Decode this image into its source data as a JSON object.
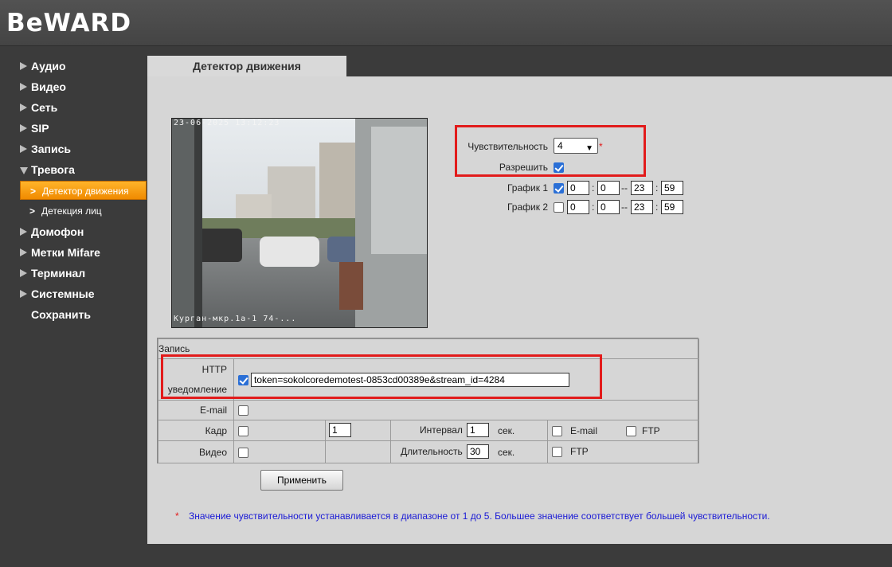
{
  "header": {
    "logo": "BeWARD"
  },
  "sidebar": {
    "items": [
      {
        "label": "Аудио"
      },
      {
        "label": "Видео"
      },
      {
        "label": "Сеть"
      },
      {
        "label": "SIP"
      },
      {
        "label": "Запись"
      },
      {
        "label": "Тревога"
      },
      {
        "label": "Домофон"
      },
      {
        "label": "Метки Mifare"
      },
      {
        "label": "Терминал"
      },
      {
        "label": "Системные"
      },
      {
        "label": "Сохранить"
      }
    ],
    "subitems": [
      {
        "label": "Детектор движения",
        "active": true
      },
      {
        "label": "Детекция лиц",
        "active": false
      }
    ]
  },
  "tab": {
    "label": "Детектор движения"
  },
  "camera": {
    "timestamp": "23-06-2025 13:12:23",
    "caption": "Курган-мкр.1а-1 74-..."
  },
  "settings": {
    "sensitivity_label": "Чувствительность",
    "sensitivity_value": "4",
    "asterisk": "*",
    "enable_label": "Разрешить",
    "schedule1_label": "График 1",
    "schedule1": {
      "h1": "0",
      "m1": "0",
      "h2": "23",
      "m2": "59"
    },
    "schedule2_label": "График 2",
    "schedule2": {
      "h1": "0",
      "m1": "0",
      "h2": "23",
      "m2": "59"
    },
    "colon": ":",
    "dash": "--"
  },
  "record": {
    "title": "Запись",
    "http_label_1": "HTTP",
    "http_label_2": "уведомление",
    "http_value": "token=sokolcoredemotest-0853cd00389e&stream_id=4284",
    "email_label": "E-mail",
    "frame_label": "Кадр",
    "frame_count": "1",
    "interval_label": "Интервал",
    "interval_value": "1",
    "sec": "сек.",
    "email_opt": "E-mail",
    "ftp_opt": "FTP",
    "video_label": "Видео",
    "duration_label": "Длительность",
    "duration_value": "30"
  },
  "apply_button": "Применить",
  "note": "Значение чувствительности устанавливается в диапазоне от 1 до 5. Большее значение соответствует большей чувствительности.",
  "colors": {
    "accent_orange": "#f5a21a",
    "highlight_red": "#e21b1b",
    "note_blue": "#1a1ad6"
  }
}
